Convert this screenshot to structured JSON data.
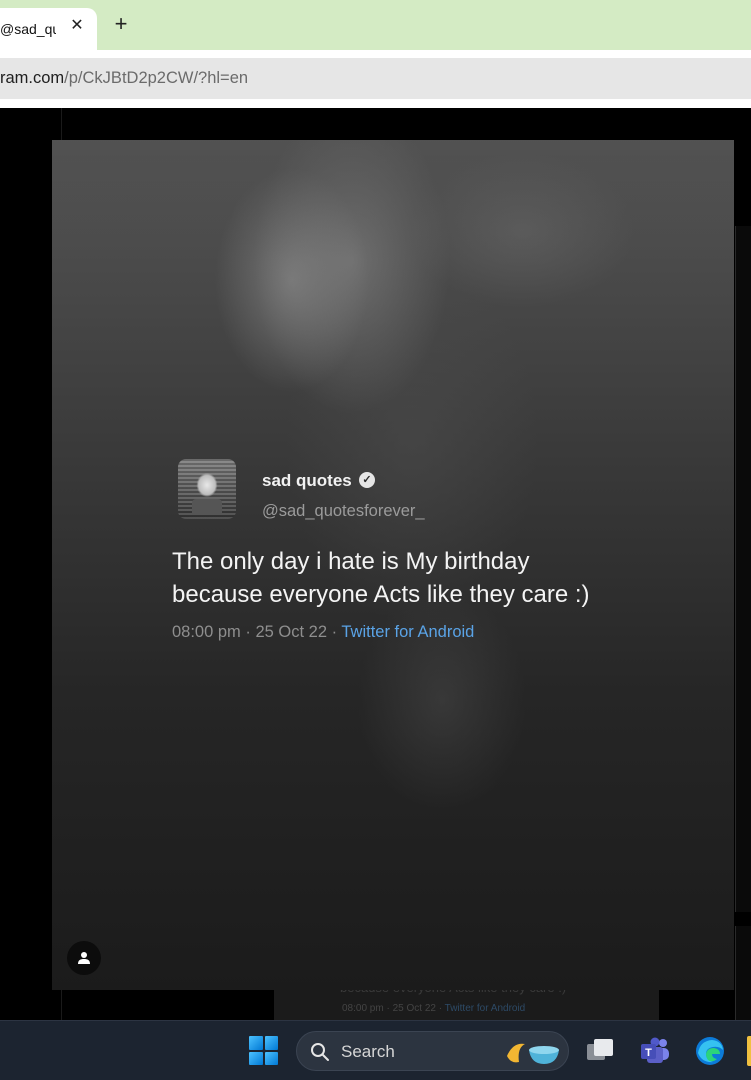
{
  "browser": {
    "tab": {
      "title": "@sad_qu",
      "close_glyph": "✕"
    },
    "new_tab_glyph": "+",
    "address": {
      "host_partial": "ram.com",
      "path": "/p/CkJBtD2p2CW/?hl=en"
    }
  },
  "post": {
    "tweet": {
      "display_name": "sad quotes",
      "verified_glyph": "✓",
      "handle": "@sad_quotesforever_",
      "body_line1": "The only day i hate is My birthday",
      "body_line2": "because everyone Acts like they care :)",
      "time_date": "08:00 pm · 25 Oct 22 · ",
      "source": "Twitter for Android"
    }
  },
  "background_post": {
    "text": "because everyone Acts like they care :)",
    "meta": "08:00 pm · 25 Oct 22 · ",
    "source": "Twitter for Android"
  },
  "taskbar": {
    "search_label": "Search",
    "icons": [
      "windows-start-icon",
      "search-icon",
      "task-view-icon",
      "teams-icon",
      "edge-icon"
    ]
  },
  "colors": {
    "tabstrip_bg": "#d4ebc4",
    "link_blue": "#5aa3e6",
    "taskbar_bg": "#1c2430"
  }
}
